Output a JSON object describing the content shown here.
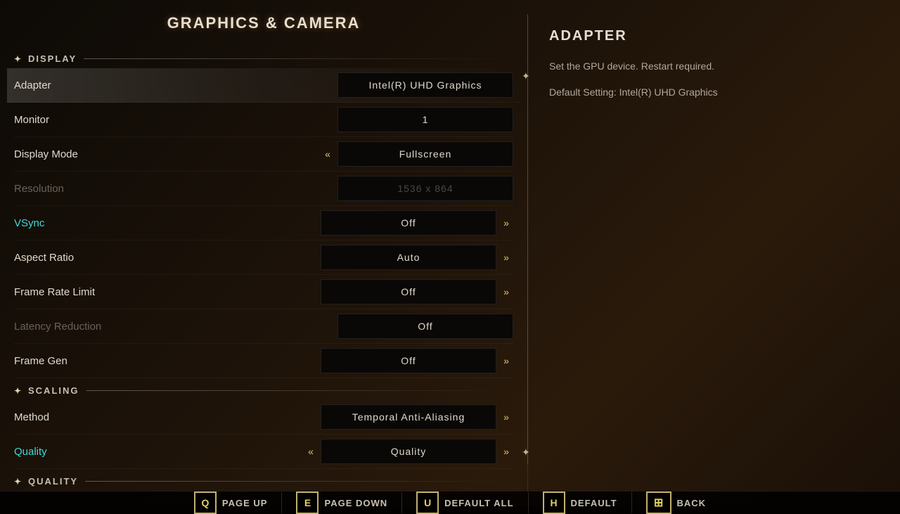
{
  "page": {
    "title": "GRAPHICS & CAMERA"
  },
  "left_panel": {
    "sections": [
      {
        "id": "display",
        "label": "DISPLAY",
        "settings": [
          {
            "id": "adapter",
            "label": "Adapter",
            "value": "Intel(R) UHD Graphics",
            "disabled": false,
            "active": true,
            "arrow_left": false,
            "arrow_right": false,
            "active_color": false
          },
          {
            "id": "monitor",
            "label": "Monitor",
            "value": "1",
            "disabled": false,
            "active": false,
            "arrow_left": false,
            "arrow_right": false,
            "active_color": false
          },
          {
            "id": "display_mode",
            "label": "Display Mode",
            "value": "Fullscreen",
            "disabled": false,
            "active": false,
            "arrow_left": true,
            "arrow_right": false,
            "active_color": false
          },
          {
            "id": "resolution",
            "label": "Resolution",
            "value": "1536 x 864",
            "disabled": true,
            "active": false,
            "arrow_left": false,
            "arrow_right": false,
            "active_color": false
          },
          {
            "id": "vsync",
            "label": "VSync",
            "value": "Off",
            "disabled": false,
            "active": false,
            "arrow_left": false,
            "arrow_right": true,
            "active_color": true
          },
          {
            "id": "aspect_ratio",
            "label": "Aspect Ratio",
            "value": "Auto",
            "disabled": false,
            "active": false,
            "arrow_left": false,
            "arrow_right": true,
            "active_color": false
          },
          {
            "id": "frame_rate_limit",
            "label": "Frame Rate Limit",
            "value": "Off",
            "disabled": false,
            "active": false,
            "arrow_left": false,
            "arrow_right": true,
            "active_color": false
          },
          {
            "id": "latency_reduction",
            "label": "Latency Reduction",
            "value": "Off",
            "disabled": true,
            "active": false,
            "arrow_left": false,
            "arrow_right": false,
            "active_color": false
          },
          {
            "id": "frame_gen",
            "label": "Frame Gen",
            "value": "Off",
            "disabled": false,
            "active": false,
            "arrow_left": false,
            "arrow_right": true,
            "active_color": false
          }
        ]
      },
      {
        "id": "scaling",
        "label": "SCALING",
        "settings": [
          {
            "id": "method",
            "label": "Method",
            "value": "Temporal Anti-Aliasing",
            "disabled": false,
            "active": false,
            "arrow_left": false,
            "arrow_right": true,
            "active_color": false
          },
          {
            "id": "quality",
            "label": "Quality",
            "value": "Quality",
            "disabled": false,
            "active": false,
            "arrow_left": true,
            "arrow_right": true,
            "active_color": true
          }
        ]
      },
      {
        "id": "quality_section",
        "label": "QUALITY",
        "settings": []
      }
    ]
  },
  "right_panel": {
    "title": "ADAPTER",
    "description": "Set the GPU device. Restart required.",
    "default_setting_label": "Default Setting:",
    "default_setting_value": "Intel(R) UHD Graphics"
  },
  "toolbar": {
    "buttons": [
      {
        "key": "Q",
        "label": "PAGE UP"
      },
      {
        "key": "E",
        "label": "PAGE DOWN"
      },
      {
        "key": "U",
        "label": "DEFAULT ALL"
      },
      {
        "key": "H",
        "label": "DEFAULT"
      },
      {
        "key": "⬛",
        "label": "BACK",
        "is_icon": true
      }
    ]
  }
}
